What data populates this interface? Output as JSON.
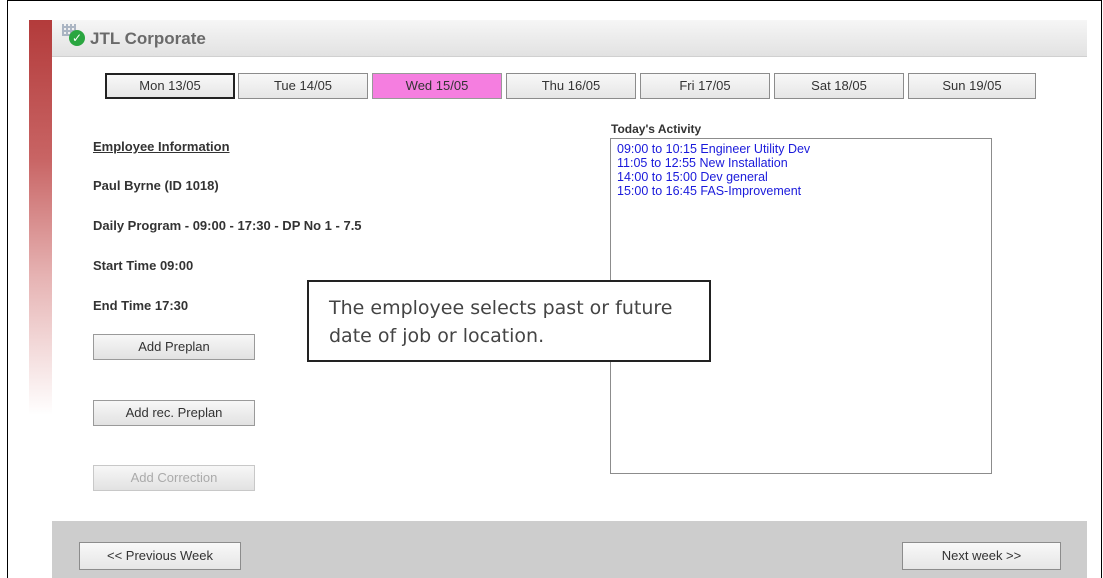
{
  "app": {
    "title": "JTL Corporate"
  },
  "days": [
    {
      "label": "Mon 13/05"
    },
    {
      "label": "Tue 14/05"
    },
    {
      "label": "Wed 15/05"
    },
    {
      "label": "Thu 16/05"
    },
    {
      "label": "Fri 17/05"
    },
    {
      "label": "Sat 18/05"
    },
    {
      "label": "Sun 19/05"
    }
  ],
  "active_day": "Wed 15/05",
  "employee": {
    "heading": "Employee Information",
    "name": "Paul Byrne (ID 1018)",
    "program": "Daily Program - 09:00 - 17:30 - DP No 1 - 7.5",
    "start": "Start Time 09:00",
    "end": "End Time 17:30"
  },
  "buttons": {
    "add_preplan": "Add Preplan",
    "add_rec_preplan": "Add rec. Preplan",
    "add_correction": "Add Correction"
  },
  "activity": {
    "title": "Today's Activity",
    "items": [
      "09:00 to 10:15 Engineer Utility Dev",
      "11:05 to 12:55 New Installation",
      "14:00 to 15:00 Dev general",
      "15:00 to 16:45 FAS-Improvement"
    ]
  },
  "callout": {
    "text": "The employee selects past or future date of job or location."
  },
  "footer": {
    "prev": "<< Previous Week",
    "next": "Next week >>"
  },
  "colors": {
    "active_day": "#f57ee0",
    "activity_text": "#1a1adb",
    "brand_check": "#2aa640"
  },
  "icons": {
    "logo": "app-logo-icon"
  }
}
